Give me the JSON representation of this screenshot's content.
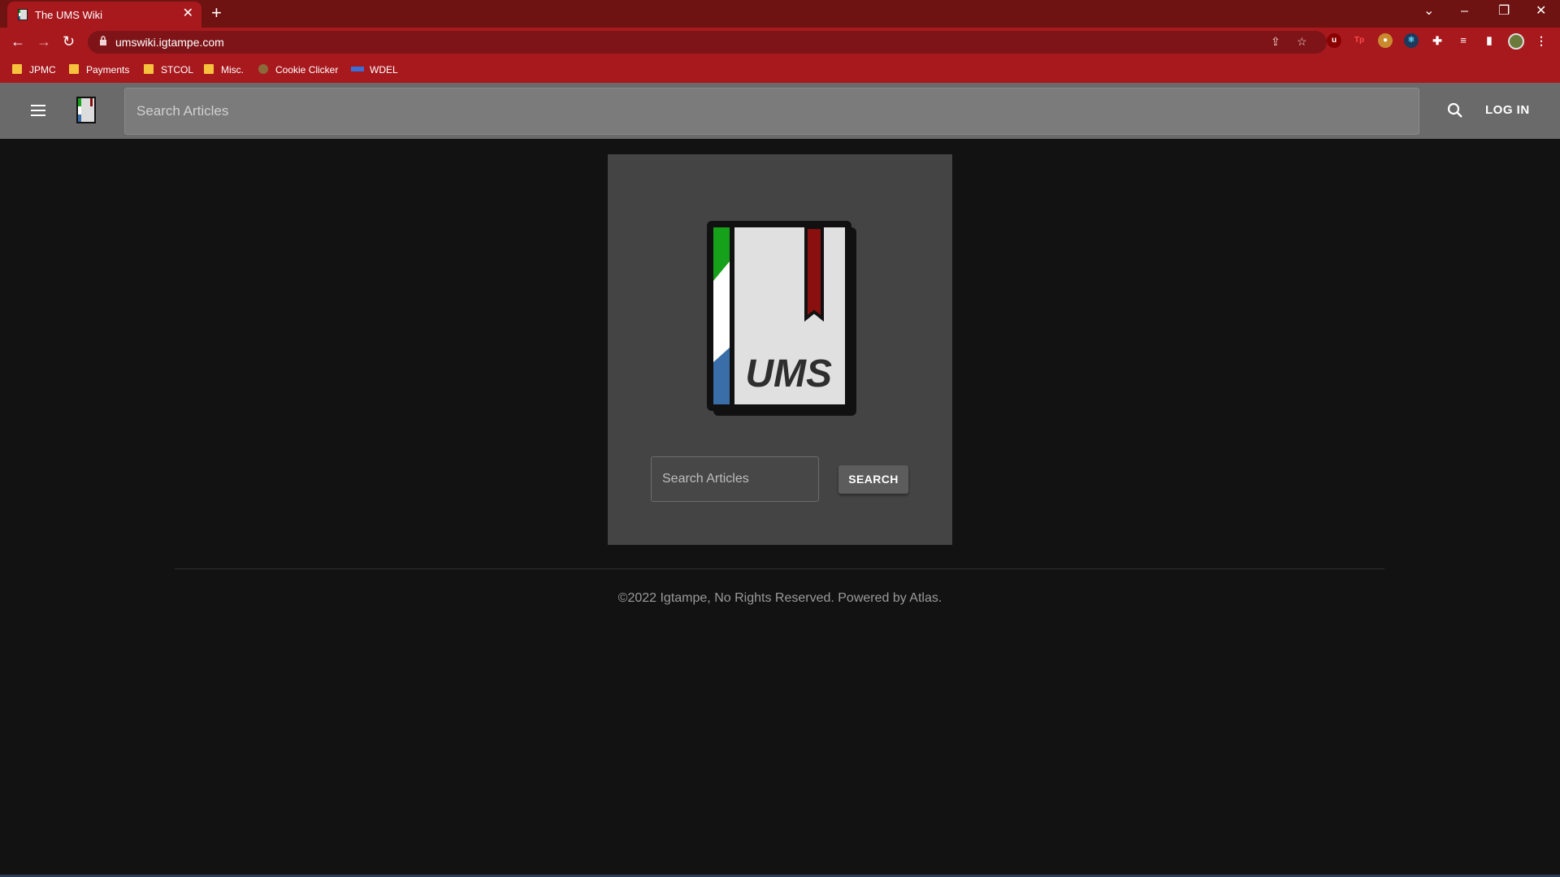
{
  "browser": {
    "tab_title": "The UMS Wiki",
    "tab_close": "✕",
    "new_tab": "+",
    "url": "umswiki.igtampe.com",
    "window_controls": {
      "minimize": "–",
      "restore": "❐",
      "close": "✕"
    },
    "extensions": [
      "uBlock",
      "Tp",
      "cookie",
      "react",
      "puzzle",
      "media",
      "sidebar",
      "profile"
    ],
    "bookmarks": [
      {
        "label": "JPMC",
        "icon": "folder-icon"
      },
      {
        "label": "Payments",
        "icon": "folder-icon"
      },
      {
        "label": "STCOL",
        "icon": "folder-icon"
      },
      {
        "label": "Misc.",
        "icon": "folder-icon"
      },
      {
        "label": "Cookie Clicker",
        "icon": "cookie-icon"
      },
      {
        "label": "WDEL",
        "icon": "wdel-icon"
      }
    ]
  },
  "appbar": {
    "search_placeholder": "Search Articles",
    "login_label": "LOG IN"
  },
  "main": {
    "logo_text": "UMS",
    "search_placeholder": "Search Articles",
    "search_button": "SEARCH"
  },
  "footer": {
    "text": "©2022 Igtampe, No Rights Reserved. Powered by Atlas."
  },
  "colors": {
    "chrome_red": "#a8191e",
    "titlebar": "#6e1212",
    "appbar": "#6a6a6a",
    "page_bg": "#121212",
    "card_bg": "#444444",
    "logo_green": "#16a11a",
    "logo_blue": "#3a6ea8",
    "logo_bookmark": "#8a0f0f"
  }
}
